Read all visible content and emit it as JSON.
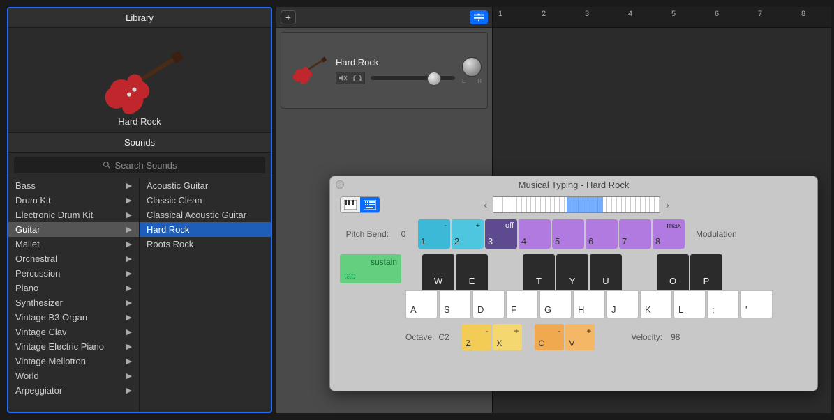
{
  "library": {
    "title": "Library",
    "instrument_name": "Hard Rock",
    "sounds_header": "Sounds",
    "search_placeholder": "Search Sounds",
    "categories": [
      "Bass",
      "Drum Kit",
      "Electronic Drum Kit",
      "Guitar",
      "Mallet",
      "Orchestral",
      "Percussion",
      "Piano",
      "Synthesizer",
      "Vintage B3 Organ",
      "Vintage Clav",
      "Vintage Electric Piano",
      "Vintage Mellotron",
      "World",
      "Arpeggiator"
    ],
    "selected_category_index": 3,
    "sub_items": [
      "Acoustic Guitar",
      "Classic Clean",
      "Classical Acoustic Guitar",
      "Hard Rock",
      "Roots Rock"
    ],
    "selected_sub_index": 3
  },
  "timeline": {
    "start": 1,
    "end": 8
  },
  "track": {
    "name": "Hard Rock",
    "pan_left": "L",
    "pan_right": "R",
    "mute_icon": "mute-icon",
    "solo_icon": "headphones-icon"
  },
  "musical_typing": {
    "title": "Musical Typing - Hard Rock",
    "pitch_bend_label": "Pitch Bend:",
    "pitch_bend_zero": "0",
    "modulation_label": "Modulation",
    "mod_keys": [
      {
        "top": "-",
        "bot": "1"
      },
      {
        "top": "+",
        "bot": "2"
      },
      {
        "top": "off",
        "bot": "3"
      },
      {
        "top": "",
        "bot": "4"
      },
      {
        "top": "",
        "bot": "5"
      },
      {
        "top": "",
        "bot": "6"
      },
      {
        "top": "",
        "bot": "7"
      },
      {
        "top": "max",
        "bot": "8"
      }
    ],
    "sustain_top": "sustain",
    "sustain_bottom": "tab",
    "black_keys": [
      "W",
      "E",
      "",
      "T",
      "Y",
      "U",
      "",
      "O",
      "P",
      ""
    ],
    "white_keys": [
      "A",
      "S",
      "D",
      "F",
      "G",
      "H",
      "J",
      "K",
      "L",
      ";",
      "'"
    ],
    "octave_label": "Octave:",
    "octave_value": "C2",
    "octave_keys": [
      {
        "top": "-",
        "bot": "Z"
      },
      {
        "top": "+",
        "bot": "X"
      }
    ],
    "velocity_keys": [
      {
        "top": "-",
        "bot": "C"
      },
      {
        "top": "+",
        "bot": "V"
      }
    ],
    "velocity_label": "Velocity:",
    "velocity_value": "98"
  },
  "icons": {
    "add": "+",
    "nav_left": "‹",
    "nav_right": "›"
  },
  "colors": {
    "selection_blue": "#1e5db8",
    "accent_blue": "#0a6cff"
  }
}
